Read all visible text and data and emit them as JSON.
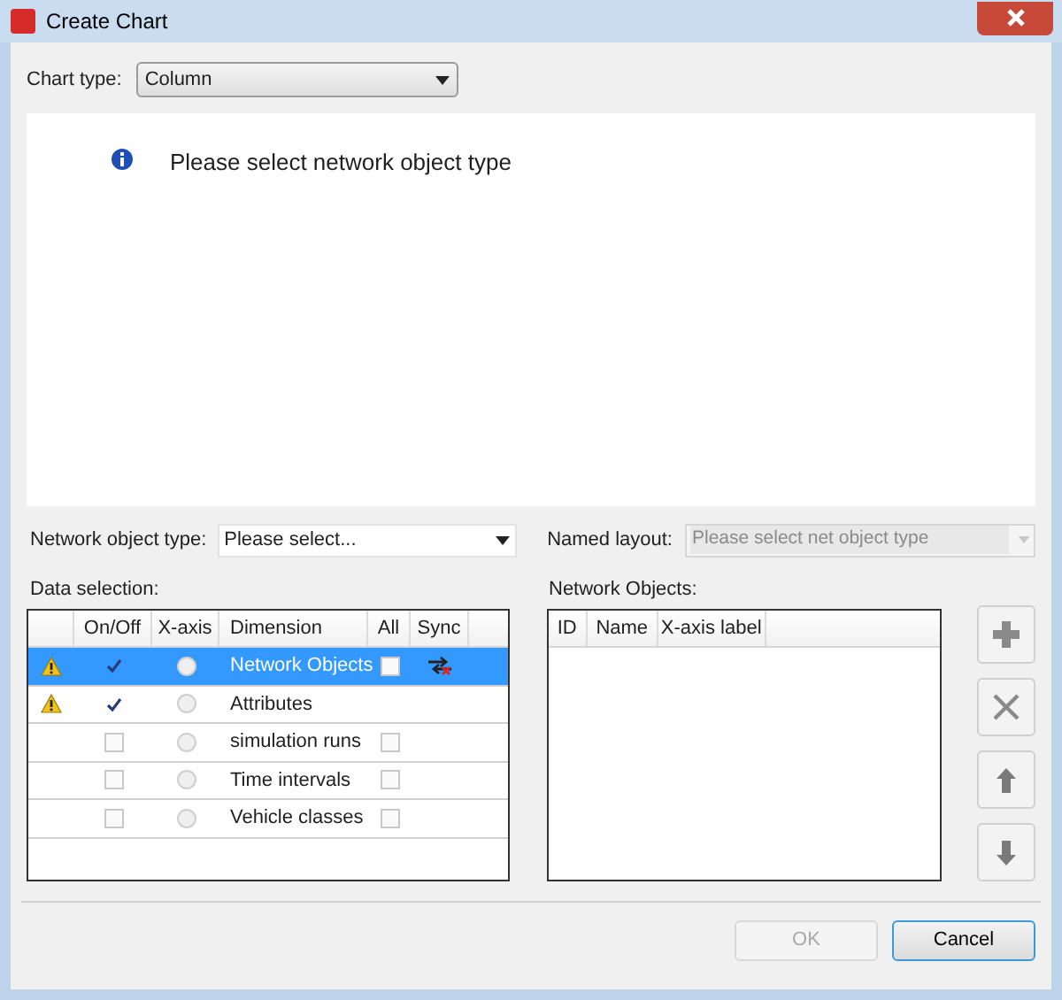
{
  "window": {
    "title": "Create Chart"
  },
  "chart_type": {
    "label": "Chart type:",
    "value": "Column"
  },
  "message": "Please select network object type",
  "network_object_type": {
    "label": "Network object type:",
    "value": "Please select..."
  },
  "named_layout": {
    "label": "Named layout:",
    "placeholder": "Please select net object type",
    "disabled": true
  },
  "data_selection": {
    "label": "Data selection:",
    "columns": [
      "On/Off",
      "X-axis",
      "Dimension",
      "All",
      "Sync"
    ],
    "rows": [
      {
        "selected": true,
        "warning": true,
        "on": true,
        "x_axis_selected": false,
        "dimension": "Network Objects",
        "all": {
          "checked": false
        },
        "sync": true
      },
      {
        "selected": false,
        "warning": true,
        "on": true,
        "x_axis_selected": false,
        "dimension": "Attributes",
        "sync": false
      },
      {
        "selected": false,
        "warning": false,
        "on": false,
        "x_axis_selected": false,
        "dimension": "simulation runs",
        "all": {
          "checked": false
        },
        "sync": false
      },
      {
        "selected": false,
        "warning": false,
        "on": false,
        "x_axis_selected": false,
        "dimension": "Time intervals",
        "all": {
          "checked": false
        },
        "sync": false
      },
      {
        "selected": false,
        "warning": false,
        "on": false,
        "x_axis_selected": false,
        "dimension": "Vehicle classes",
        "all": {
          "checked": false
        },
        "sync": false
      }
    ]
  },
  "network_objects": {
    "label": "Network Objects:",
    "columns": [
      "ID",
      "Name",
      "X-axis label"
    ]
  },
  "side_buttons": [
    {
      "kind": "add"
    },
    {
      "kind": "remove"
    },
    {
      "kind": "up"
    },
    {
      "kind": "down"
    }
  ],
  "buttons": [
    {
      "label": "OK",
      "disabled": true
    },
    {
      "label": "Cancel",
      "disabled": false
    }
  ]
}
